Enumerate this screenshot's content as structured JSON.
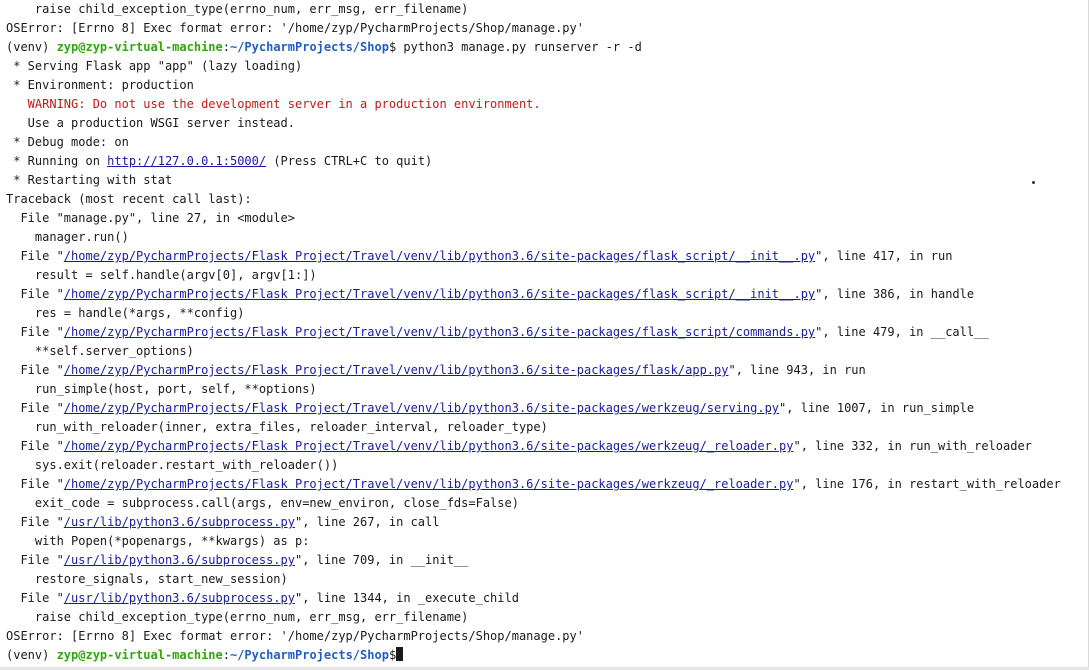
{
  "terminal": {
    "lines": [
      [
        {
          "t": "    raise child_exception_type(errno_num, err_msg, err_filename)"
        }
      ],
      [
        {
          "t": "OSError: [Errno 8] Exec format error: '/home/zyp/PycharmProjects/Shop/manage.py'"
        }
      ],
      [
        {
          "t": "(venv) "
        },
        {
          "t": "zyp@zyp-virtual-machine",
          "s": "user"
        },
        {
          "t": ":"
        },
        {
          "t": "~/PycharmProjects/Shop",
          "s": "path"
        },
        {
          "t": "$ python3 manage.py runserver -r -d"
        }
      ],
      [
        {
          "t": " * Serving Flask app \"app\" (lazy loading)"
        }
      ],
      [
        {
          "t": " * Environment: production"
        }
      ],
      [
        {
          "t": "   WARNING: Do not use the development server in a production environment.",
          "s": "warn"
        }
      ],
      [
        {
          "t": "   Use a production WSGI server instead."
        }
      ],
      [
        {
          "t": " * Debug mode: on"
        }
      ],
      [
        {
          "t": " * Running on "
        },
        {
          "t": "http://127.0.0.1:5000/",
          "s": "link"
        },
        {
          "t": " (Press CTRL+C to quit)"
        }
      ],
      [
        {
          "t": " * Restarting with stat"
        }
      ],
      [
        {
          "t": "Traceback (most recent call last):"
        }
      ],
      [
        {
          "t": "  File \"manage.py\", line 27, in <module>"
        }
      ],
      [
        {
          "t": "    manager.run()"
        }
      ],
      [
        {
          "t": "  File \""
        },
        {
          "t": "/home/zyp/PycharmProjects/Flask Project/Travel/venv/lib/python3.6/site-packages/flask_script/__init__.py",
          "s": "link"
        },
        {
          "t": "\", line 417, in run"
        }
      ],
      [
        {
          "t": "    result = self.handle(argv[0], argv[1:])"
        }
      ],
      [
        {
          "t": "  File \""
        },
        {
          "t": "/home/zyp/PycharmProjects/Flask Project/Travel/venv/lib/python3.6/site-packages/flask_script/__init__.py",
          "s": "link"
        },
        {
          "t": "\", line 386, in handle"
        }
      ],
      [
        {
          "t": "    res = handle(*args, **config)"
        }
      ],
      [
        {
          "t": "  File \""
        },
        {
          "t": "/home/zyp/PycharmProjects/Flask Project/Travel/venv/lib/python3.6/site-packages/flask_script/commands.py",
          "s": "link"
        },
        {
          "t": "\", line 479, in __call__"
        }
      ],
      [
        {
          "t": "    **self.server_options)"
        }
      ],
      [
        {
          "t": "  File \""
        },
        {
          "t": "/home/zyp/PycharmProjects/Flask Project/Travel/venv/lib/python3.6/site-packages/flask/app.py",
          "s": "link"
        },
        {
          "t": "\", line 943, in run"
        }
      ],
      [
        {
          "t": "    run_simple(host, port, self, **options)"
        }
      ],
      [
        {
          "t": "  File \""
        },
        {
          "t": "/home/zyp/PycharmProjects/Flask Project/Travel/venv/lib/python3.6/site-packages/werkzeug/serving.py",
          "s": "link"
        },
        {
          "t": "\", line 1007, in run_simple"
        }
      ],
      [
        {
          "t": "    run_with_reloader(inner, extra_files, reloader_interval, reloader_type)"
        }
      ],
      [
        {
          "t": "  File \""
        },
        {
          "t": "/home/zyp/PycharmProjects/Flask Project/Travel/venv/lib/python3.6/site-packages/werkzeug/_reloader.py",
          "s": "link"
        },
        {
          "t": "\", line 332, in run_with_reloader"
        }
      ],
      [
        {
          "t": "    sys.exit(reloader.restart_with_reloader())"
        }
      ],
      [
        {
          "t": "  File \""
        },
        {
          "t": "/home/zyp/PycharmProjects/Flask Project/Travel/venv/lib/python3.6/site-packages/werkzeug/_reloader.py",
          "s": "link"
        },
        {
          "t": "\", line 176, in restart_with_reloader"
        }
      ],
      [
        {
          "t": "    exit_code = subprocess.call(args, env=new_environ, close_fds=False)"
        }
      ],
      [
        {
          "t": "  File \""
        },
        {
          "t": "/usr/lib/python3.6/subprocess.py",
          "s": "link"
        },
        {
          "t": "\", line 267, in call"
        }
      ],
      [
        {
          "t": "    with Popen(*popenargs, **kwargs) as p:"
        }
      ],
      [
        {
          "t": "  File \""
        },
        {
          "t": "/usr/lib/python3.6/subprocess.py",
          "s": "link"
        },
        {
          "t": "\", line 709, in __init__"
        }
      ],
      [
        {
          "t": "    restore_signals, start_new_session)"
        }
      ],
      [
        {
          "t": "  File \""
        },
        {
          "t": "/usr/lib/python3.6/subprocess.py",
          "s": "link"
        },
        {
          "t": "\", line 1344, in _execute_child"
        }
      ],
      [
        {
          "t": "    raise child_exception_type(errno_num, err_msg, err_filename)"
        }
      ],
      [
        {
          "t": "OSError: [Errno 8] Exec format error: '/home/zyp/PycharmProjects/Shop/manage.py'"
        }
      ],
      [
        {
          "t": "(venv) "
        },
        {
          "t": "zyp@zyp-virtual-machine",
          "s": "user"
        },
        {
          "t": ":"
        },
        {
          "t": "~/PycharmProjects/Shop",
          "s": "path"
        },
        {
          "t": "$"
        },
        {
          "t": "",
          "s": "cursor"
        }
      ]
    ]
  },
  "colors": {
    "background": "#ffffff",
    "text": "#1a1a1a",
    "prompt_user": "#2ea80b",
    "prompt_path": "#1f5fbf",
    "warning": "#c61717",
    "link": "#1a1aa6"
  }
}
